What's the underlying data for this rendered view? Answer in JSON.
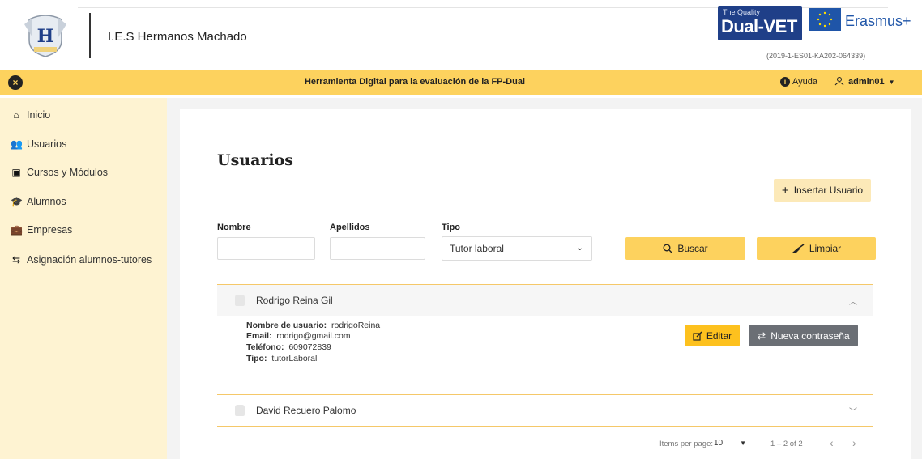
{
  "header": {
    "school_name": "I.E.S Hermanos Machado",
    "brand_small": "The Quality",
    "brand_main": "Dual-VET",
    "erasmus": "Erasmus+",
    "grant_code": "(2019-1-ES01-KA202-064339)"
  },
  "topbar": {
    "title": "Herramienta Digital para la evaluación de la FP-Dual",
    "help_label": "Ayuda",
    "user_label": "admin01"
  },
  "sidebar": {
    "items": [
      {
        "label": "Inicio",
        "icon": "home-icon"
      },
      {
        "label": "Usuarios",
        "icon": "users-icon"
      },
      {
        "label": "Cursos y Módulos",
        "icon": "book-reader-icon"
      },
      {
        "label": "Alumnos",
        "icon": "graduation-cap-icon"
      },
      {
        "label": "Empresas",
        "icon": "briefcase-icon"
      },
      {
        "label": "Asignación alumnos-tutores",
        "icon": "people-link-icon"
      }
    ]
  },
  "main": {
    "title": "Usuarios",
    "insert_button": "Insertar Usuario",
    "filters": {
      "nombre_label": "Nombre",
      "nombre_value": "",
      "apellidos_label": "Apellidos",
      "apellidos_value": "",
      "tipo_label": "Tipo",
      "tipo_value": "Tutor laboral"
    },
    "search_button": "Buscar",
    "clear_button": "Limpiar",
    "users": [
      {
        "name": "Rodrigo Reina Gil",
        "expanded": true,
        "username_label": "Nombre de usuario:",
        "username": "rodrigoReina",
        "email_label": "Email:",
        "email": "rodrigo@gmail.com",
        "phone_label": "Teléfono:",
        "phone": "609072839",
        "type_label": "Tipo:",
        "type": "tutorLaboral",
        "edit_button": "Editar",
        "password_button": "Nueva contraseña"
      },
      {
        "name": "David Recuero Palomo",
        "expanded": false
      }
    ],
    "paginator": {
      "items_per_page_label": "Items per page:",
      "items_per_page": "10",
      "range": "1 – 2 of 2"
    }
  },
  "colors": {
    "accent_yellow": "#fdd25e",
    "sidebar_bg": "#fef3d2",
    "password_btn": "#6b6f75"
  }
}
